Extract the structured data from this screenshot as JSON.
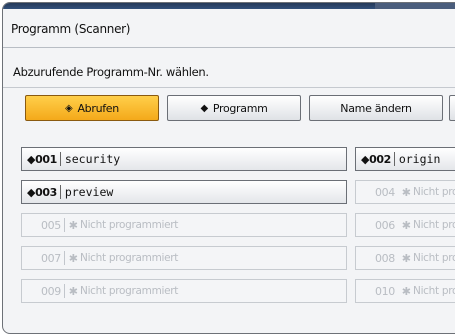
{
  "window": {
    "title": "Programm (Scanner)"
  },
  "instruction": "Abzurufende Programm-Nr. wählen.",
  "colors": {
    "active_button": "#f4a91a",
    "title_bar": "#2b4468"
  },
  "buttons": [
    {
      "label": "Abrufen",
      "icon": "diamond-arrow-icon",
      "active": true
    },
    {
      "label": "Programm",
      "icon": "diamond-icon",
      "active": false
    },
    {
      "label": "Name ändern",
      "active": false
    }
  ],
  "programs": [
    {
      "number": "001",
      "name": "security"
    },
    {
      "number": "002",
      "name": "origin"
    },
    {
      "number": "003",
      "name": "preview"
    },
    {
      "number": "004",
      "name": "Nicht programmiert"
    },
    {
      "number": "005",
      "name": "Nicht programmiert"
    },
    {
      "number": "006",
      "name": "Nicht programmiert"
    },
    {
      "number": "007",
      "name": "Nicht programmiert"
    },
    {
      "number": "008",
      "name": "Nicht programmiert"
    },
    {
      "number": "009",
      "name": "Nicht programmiert"
    },
    {
      "number": "010",
      "name": "Nicht programmiert"
    }
  ],
  "markers": {
    "program_icon": "◆",
    "unprogrammed_icon": "✱"
  }
}
